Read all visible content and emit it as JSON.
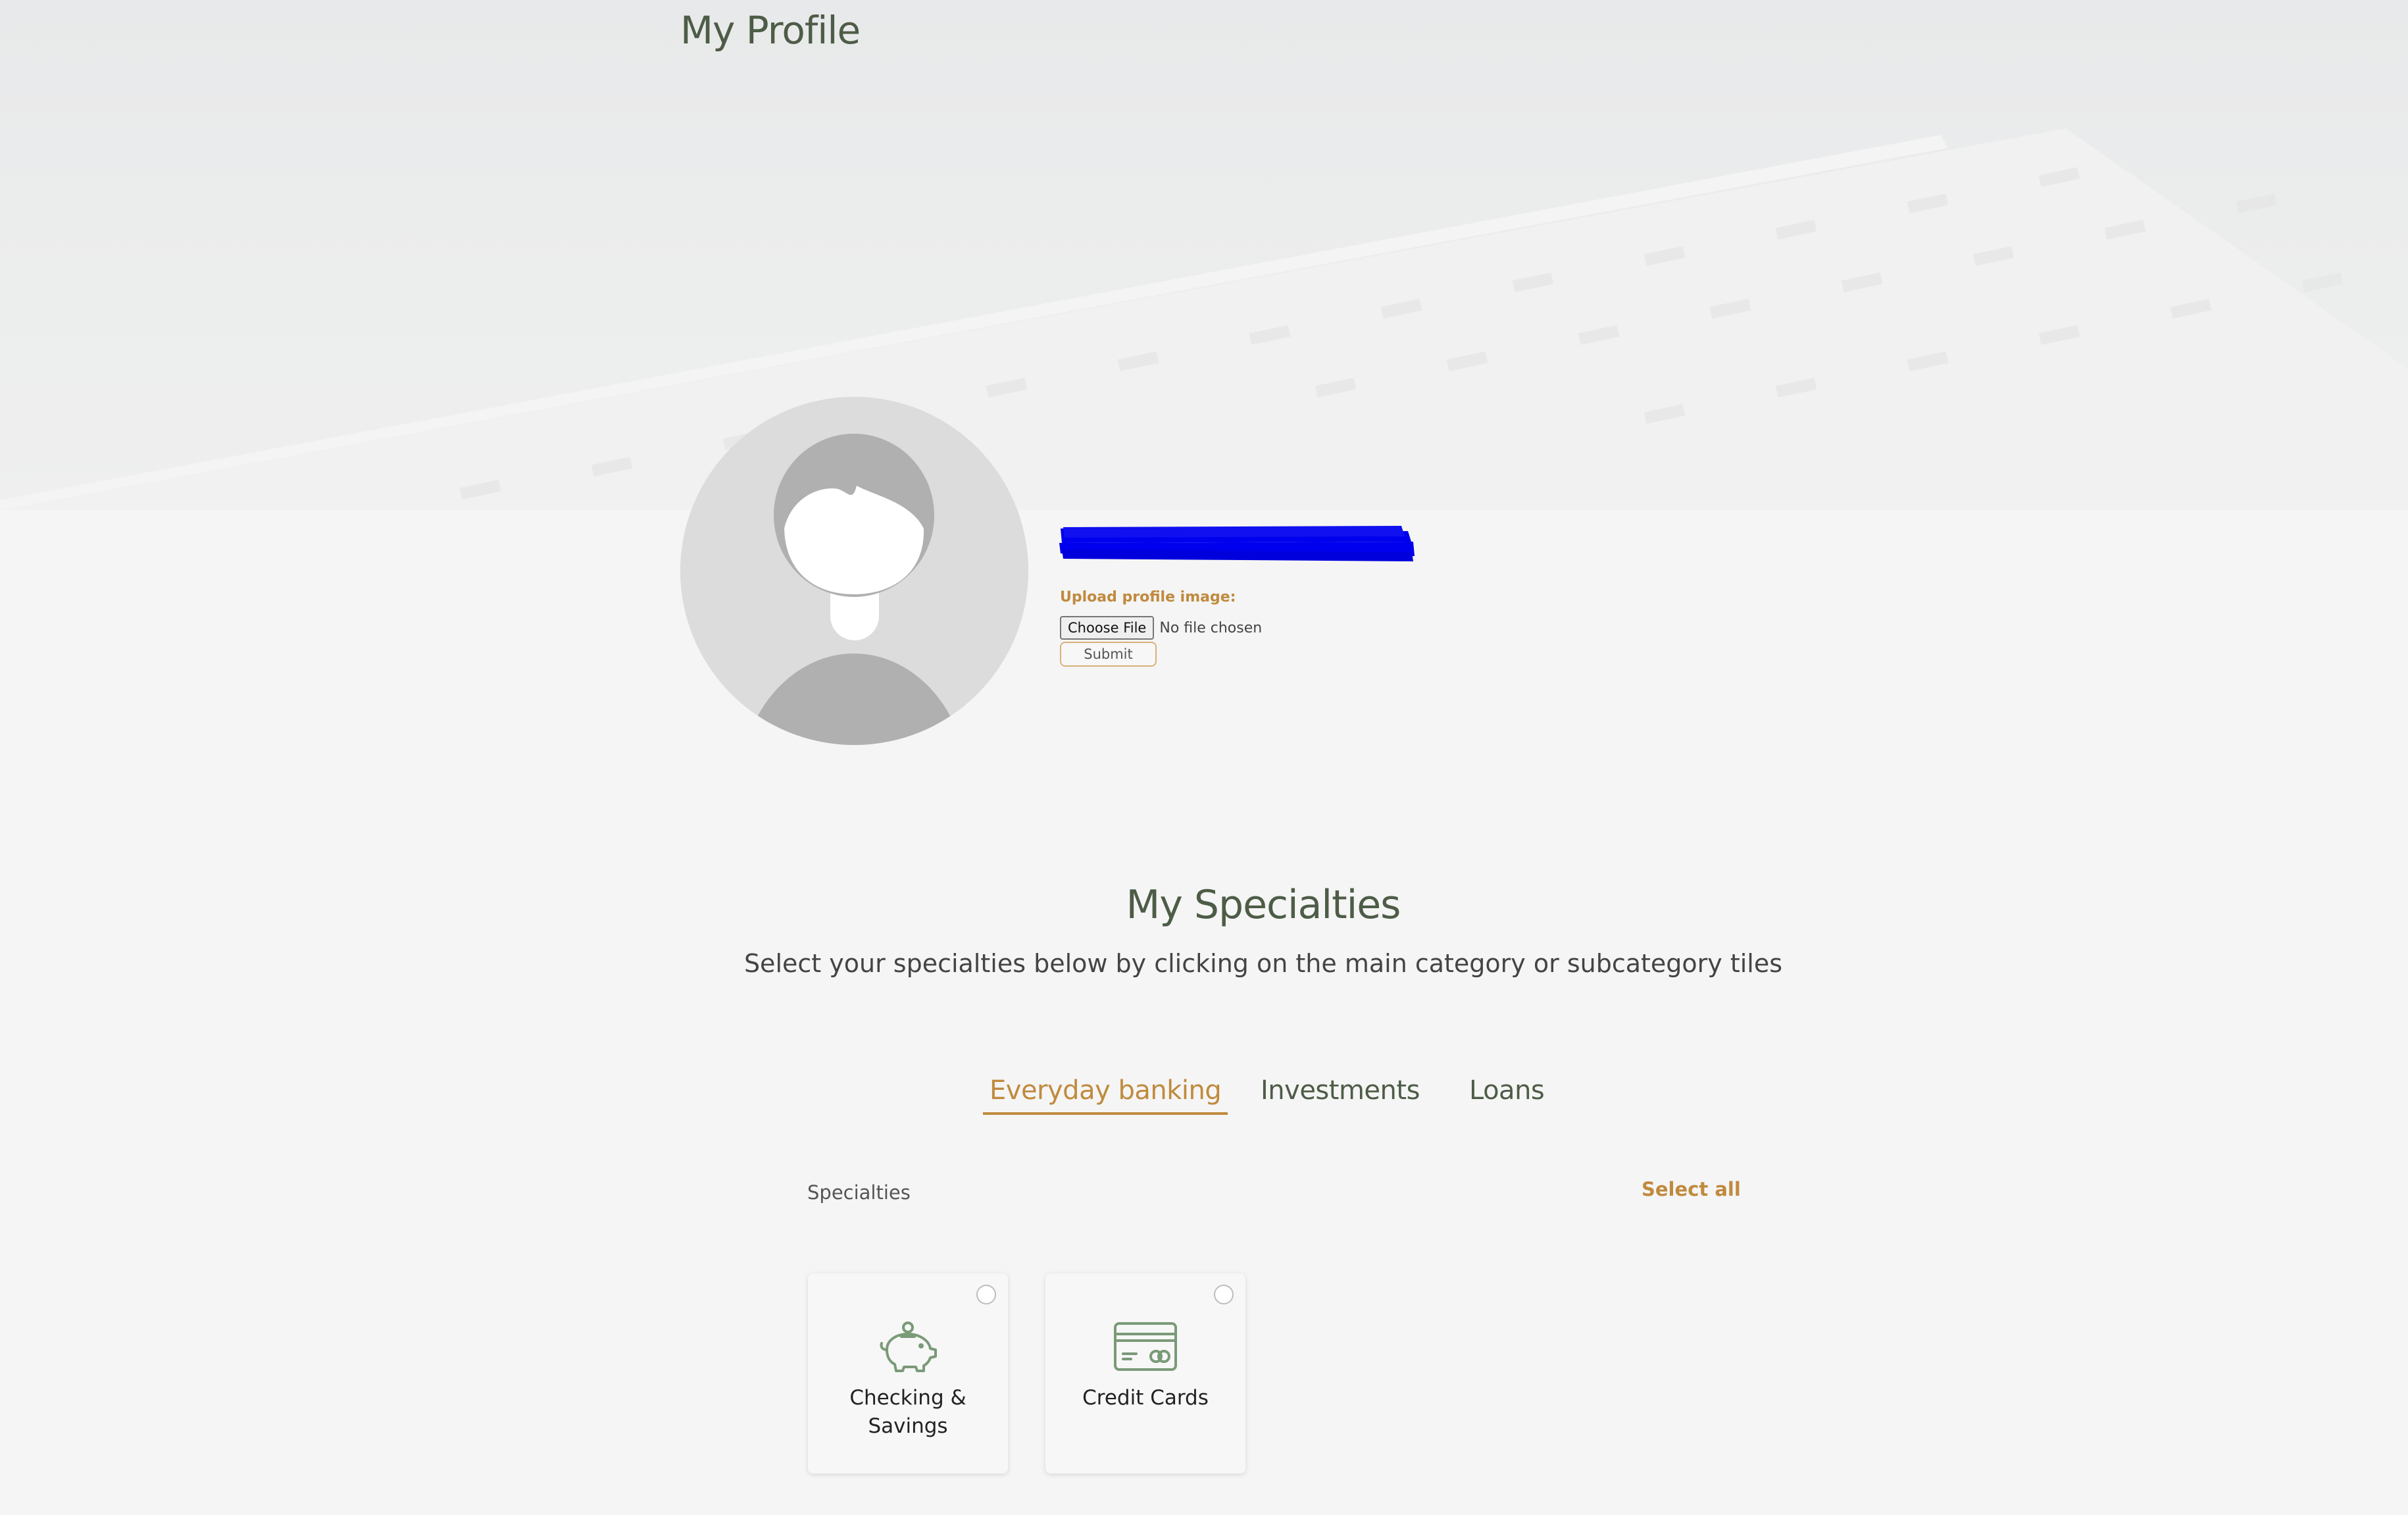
{
  "header": {
    "title": "My Profile"
  },
  "profile": {
    "name_redacted": "",
    "upload_label": "Upload profile image:",
    "choose_file_label": "Choose File",
    "no_file_text": "No file chosen",
    "submit_label": "Submit",
    "avatar_icon": "default-user-silhouette"
  },
  "specialties": {
    "title": "My Specialties",
    "subtitle": "Select your specialties below by clicking on the main category or subcategory tiles",
    "tabs": [
      {
        "label": "Everyday banking",
        "active": true
      },
      {
        "label": "Investments",
        "active": false
      },
      {
        "label": "Loans",
        "active": false
      }
    ],
    "list_label": "Specialties",
    "select_all_label": "Select all",
    "tiles": [
      {
        "label": "Checking & Savings",
        "icon": "piggy-bank-icon",
        "selected": false
      },
      {
        "label": "Credit Cards",
        "icon": "credit-card-icon",
        "selected": false
      }
    ]
  },
  "colors": {
    "accent": "#c08a3e",
    "heading": "#4d5c46",
    "icon_green": "#7a9a78",
    "redaction": "#0000ee"
  }
}
